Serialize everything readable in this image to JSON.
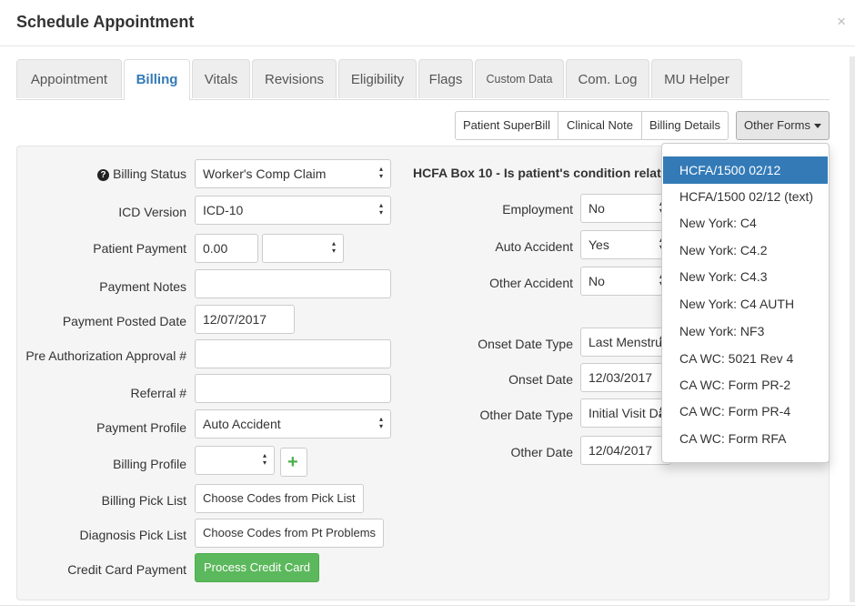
{
  "modal": {
    "title": "Schedule Appointment",
    "close_symbol": "×"
  },
  "tabs": [
    {
      "label": "Appointment"
    },
    {
      "label": "Billing"
    },
    {
      "label": "Vitals"
    },
    {
      "label": "Revisions"
    },
    {
      "label": "Eligibility"
    },
    {
      "label": "Flags"
    },
    {
      "label": "Custom Data"
    },
    {
      "label": "Com. Log"
    },
    {
      "label": "MU Helper"
    }
  ],
  "active_tab": "Billing",
  "form_buttons": {
    "patient_superbill": "Patient SuperBill",
    "clinical_note": "Clinical Note",
    "billing_details": "Billing Details",
    "other_forms": "Other Forms"
  },
  "left_form": {
    "billing_status": {
      "label": "Billing Status",
      "value": "Worker's Comp Claim",
      "help_icon": "?"
    },
    "icd_version": {
      "label": "ICD Version",
      "value": "ICD-10"
    },
    "patient_payment": {
      "label": "Patient Payment",
      "value": "0.00",
      "method": ""
    },
    "payment_notes": {
      "label": "Payment Notes",
      "value": ""
    },
    "payment_posted_date": {
      "label": "Payment Posted Date",
      "value": "12/07/2017"
    },
    "pre_auth": {
      "label": "Pre Authorization Approval #",
      "value": ""
    },
    "referral": {
      "label": "Referral #",
      "value": ""
    },
    "payment_profile": {
      "label": "Payment Profile",
      "value": "Auto Accident"
    },
    "billing_profile": {
      "label": "Billing Profile",
      "value": "",
      "add_symbol": "+"
    },
    "billing_pick_list": {
      "label": "Billing Pick List",
      "button": "Choose Codes from Pick List"
    },
    "diagnosis_pick_list": {
      "label": "Diagnosis Pick List",
      "button": "Choose Codes from Pt Problems"
    },
    "credit_card_payment": {
      "label": "Credit Card Payment",
      "button": "Process Credit Card"
    }
  },
  "right_form": {
    "heading": "HCFA Box 10 - Is patient's condition relat",
    "employment": {
      "label": "Employment",
      "value": "No"
    },
    "auto_accident": {
      "label": "Auto Accident",
      "value": "Yes"
    },
    "other_accident": {
      "label": "Other Accident",
      "value": "No"
    },
    "onset_date_type": {
      "label": "Onset Date Type",
      "value": "Last Menstru"
    },
    "onset_date": {
      "label": "Onset Date",
      "value": "12/03/2017"
    },
    "other_date_type": {
      "label": "Other Date Type",
      "value": "Initial Visit Da"
    },
    "other_date": {
      "label": "Other Date",
      "value": "12/04/2017"
    }
  },
  "other_forms_menu": {
    "items": [
      {
        "label": "HCFA/1500 02/12"
      },
      {
        "label": "HCFA/1500 02/12 (text)"
      },
      {
        "label": "New York: C4"
      },
      {
        "label": "New York: C4.2"
      },
      {
        "label": "New York: C4.3"
      },
      {
        "label": "New York: C4 AUTH"
      },
      {
        "label": "New York: NF3"
      },
      {
        "label": "CA WC: 5021 Rev 4"
      },
      {
        "label": "CA WC: Form PR-2"
      },
      {
        "label": "CA WC: Form PR-4"
      },
      {
        "label": "CA WC: Form RFA"
      }
    ],
    "highlighted": "HCFA/1500 02/12"
  },
  "colors": {
    "accent": "#337ab7",
    "success": "#5cb85c",
    "panel": "#f5f5f5"
  }
}
